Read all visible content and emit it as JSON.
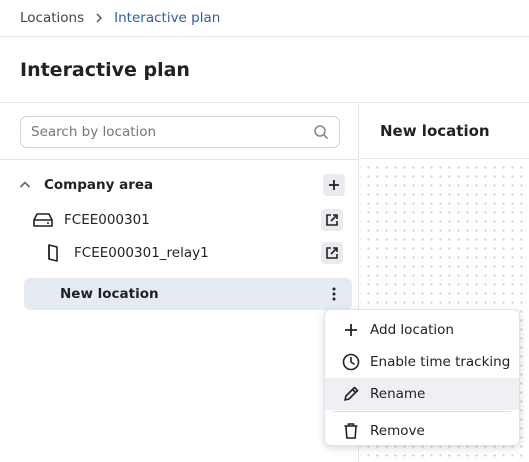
{
  "breadcrumb": {
    "root": "Locations",
    "current": "Interactive plan"
  },
  "page": {
    "title": "Interactive plan"
  },
  "search": {
    "placeholder": "Search by location",
    "value": ""
  },
  "tree": {
    "company_area": "Company area",
    "gateway": "FCEE000301",
    "relay": "FCEE000301_relay1",
    "new_location": "New location"
  },
  "detail": {
    "title": "New location"
  },
  "context_menu": {
    "add_location": "Add location",
    "enable_time_tracking": "Enable time tracking",
    "rename": "Rename",
    "remove": "Remove"
  },
  "colors": {
    "accent": "#2b5fa8",
    "selected_row": "#e6ebf3",
    "icon_button": "#e9ebee"
  }
}
